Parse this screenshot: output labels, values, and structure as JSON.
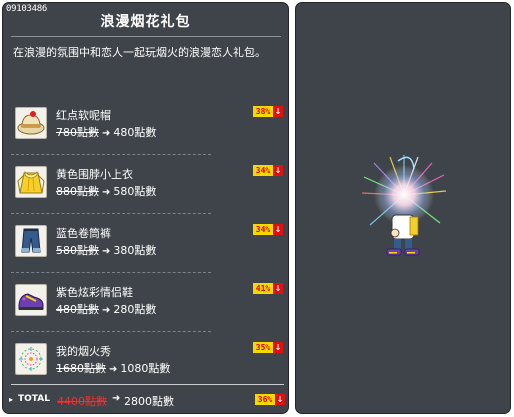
{
  "package": {
    "id": "09103486",
    "title": "浪漫烟花礼包",
    "description": "在浪漫的氛围中和恋人一起玩烟火的浪漫恋人礼包。"
  },
  "items": [
    {
      "name": "红点软呢帽",
      "old_price": "780點數",
      "new_price": "480點數",
      "discount": "38%",
      "icon": "red-dot-fedora-icon"
    },
    {
      "name": "黄色围脖小上衣",
      "old_price": "880點數",
      "new_price": "580點數",
      "discount": "34%",
      "icon": "yellow-scarf-top-icon"
    },
    {
      "name": "蓝色卷筒裤",
      "old_price": "580點數",
      "new_price": "380點數",
      "discount": "34%",
      "icon": "blue-rolled-jeans-icon"
    },
    {
      "name": "紫色炫彩情侣鞋",
      "old_price": "480點數",
      "new_price": "280點數",
      "discount": "41%",
      "icon": "purple-couple-shoes-icon"
    },
    {
      "name": "我的烟火秀",
      "old_price": "1680點數",
      "new_price": "1080點數",
      "discount": "35%",
      "icon": "fireworks-show-icon"
    }
  ],
  "total": {
    "label": "TOTAL",
    "old_price": "4400點數",
    "new_price": "2800點數",
    "discount": "36%"
  },
  "symbols": {
    "arrow": "➜",
    "down_arrow": "↓",
    "bullet": "▸"
  },
  "colors": {
    "panel_bg": "#3e4449",
    "badge_bg": "#f5d800",
    "badge_text": "#e60000",
    "badge_arrow_bg": "#e01010",
    "total_old_price": "#ff2a2a"
  }
}
